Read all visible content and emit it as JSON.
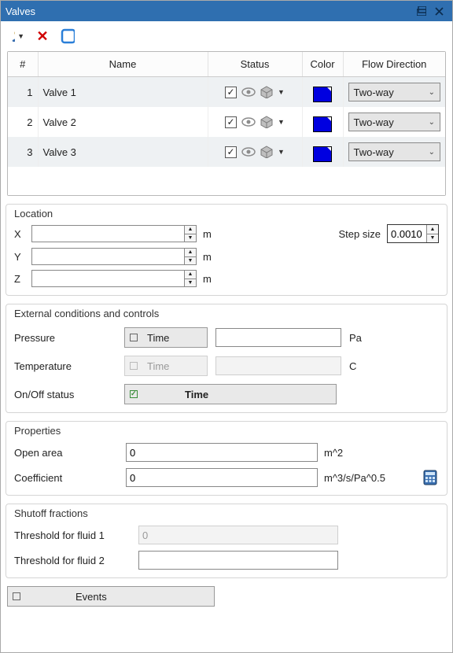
{
  "title": "Valves",
  "table": {
    "headers": {
      "num": "#",
      "name": "Name",
      "status": "Status",
      "color": "Color",
      "flow": "Flow Direction"
    },
    "rows": [
      {
        "num": "1",
        "name": "Valve 1",
        "checked": true,
        "color": "#0000e0",
        "flow": "Two-way"
      },
      {
        "num": "2",
        "name": "Valve 2",
        "checked": true,
        "color": "#0000e0",
        "flow": "Two-way"
      },
      {
        "num": "3",
        "name": "Valve 3",
        "checked": true,
        "color": "#0000e0",
        "flow": "Two-way"
      }
    ]
  },
  "location": {
    "label": "Location",
    "x_label": "X",
    "x_value": "",
    "x_unit": "m",
    "y_label": "Y",
    "y_value": "",
    "y_unit": "m",
    "z_label": "Z",
    "z_value": "",
    "z_unit": "m",
    "step_label": "Step size",
    "step_value": "0.0010"
  },
  "external": {
    "label": "External conditions and controls",
    "pressure_label": "Pressure",
    "pressure_time": "Time",
    "pressure_value": "",
    "pressure_unit": "Pa",
    "temperature_label": "Temperature",
    "temperature_time": "Time",
    "temperature_value": "",
    "temperature_unit": "C",
    "onoff_label": "On/Off status",
    "onoff_time": "Time"
  },
  "properties": {
    "label": "Properties",
    "open_area_label": "Open area",
    "open_area_value": "0",
    "open_area_unit": "m^2",
    "coeff_label": "Coefficient",
    "coeff_value": "0",
    "coeff_unit": "m^3/s/Pa^0.5"
  },
  "shutoff": {
    "label": "Shutoff fractions",
    "t1_label": "Threshold for fluid 1",
    "t1_value": "0",
    "t2_label": "Threshold for fluid 2",
    "t2_value": ""
  },
  "events_label": "Events"
}
